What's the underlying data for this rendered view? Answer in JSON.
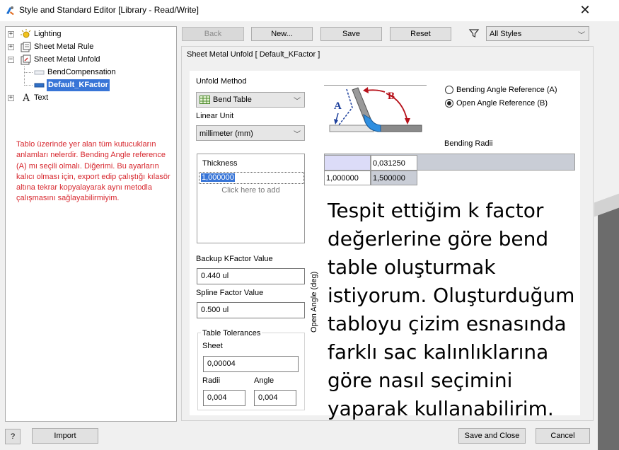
{
  "window": {
    "title": "Style and Standard Editor [Library - Read/Write]"
  },
  "tree": {
    "items": [
      {
        "label": "Lighting",
        "icon": "lighting-icon",
        "expander": "+"
      },
      {
        "label": "Sheet Metal Rule",
        "icon": "sheet-metal-rule-icon",
        "expander": "+"
      },
      {
        "label": "Sheet Metal Unfold",
        "icon": "sheet-metal-unfold-icon",
        "expander": "−"
      },
      {
        "label": "BendCompensation",
        "icon": "unfold-item-icon",
        "expander": ""
      },
      {
        "label": "Default_KFactor",
        "icon": "unfold-item-icon",
        "expander": "",
        "selected": true
      },
      {
        "label": "Text",
        "icon": "text-style-icon",
        "expander": "+"
      }
    ]
  },
  "note": "Tablo üzerinde yer alan tüm kutucukların anlamları  nelerdir. Bending Angle reference (A) mı seçili olmalı. Diğerimi. Bu ayarların kalıcı olması için, export edip çalıştığı kılasör altına tekrar kopyalayarak aynı metodla çalışmasını sağlayabilirmiyim.",
  "toolbar": {
    "back": "Back",
    "new": "New...",
    "save": "Save",
    "reset": "Reset",
    "filter_value": "All Styles"
  },
  "panel": {
    "header": "Sheet Metal Unfold [ Default_KFactor ]",
    "unfold_method_label": "Unfold Method",
    "unfold_method_value": "Bend Table",
    "linear_unit_label": "Linear Unit",
    "linear_unit_value": "millimeter (mm)",
    "thickness": {
      "header": "Thickness",
      "value": "1,000000",
      "add_hint": "Click here to add"
    },
    "backup_kfactor_label": "Backup KFactor Value",
    "backup_kfactor_value": "0.440 ul",
    "spline_factor_label": "Spline Factor Value",
    "spline_factor_value": "0.500 ul",
    "tolerances": {
      "title": "Table Tolerances",
      "sheet_label": "Sheet",
      "sheet_value": "0,00004",
      "radii_label": "Radii",
      "radii_value": "0,004",
      "angle_label": "Angle",
      "angle_value": "0,004"
    },
    "diagram": {
      "label_a": "A",
      "label_b": "B"
    },
    "radio_options": [
      {
        "label": "Bending Angle Reference (A)",
        "selected": false
      },
      {
        "label": "Open Angle Reference (B)",
        "selected": true
      }
    ],
    "bend_table": {
      "radii_label": "Bending Radii",
      "open_angle_label": "Open Angle (deg)",
      "radius_header": "0,031250",
      "row_thickness": "1,000000",
      "row_value": "1,500000"
    },
    "overlay_text": "Tespit ettiğim k factor değerlerine göre bend table oluşturmak istiyorum. Oluşturduğum tabloyu çizim esnasında farklı sac kalınlıklarına göre nasıl seçimini yaparak kullanabilirim."
  },
  "footer": {
    "help": "?",
    "import": "Import",
    "save_close": "Save and Close",
    "cancel": "Cancel"
  },
  "colors": {
    "selection": "#3875d7",
    "note_text": "#d7282f",
    "grid_header": "#dcdcf8",
    "grid_gray": "#c9cdd6"
  }
}
